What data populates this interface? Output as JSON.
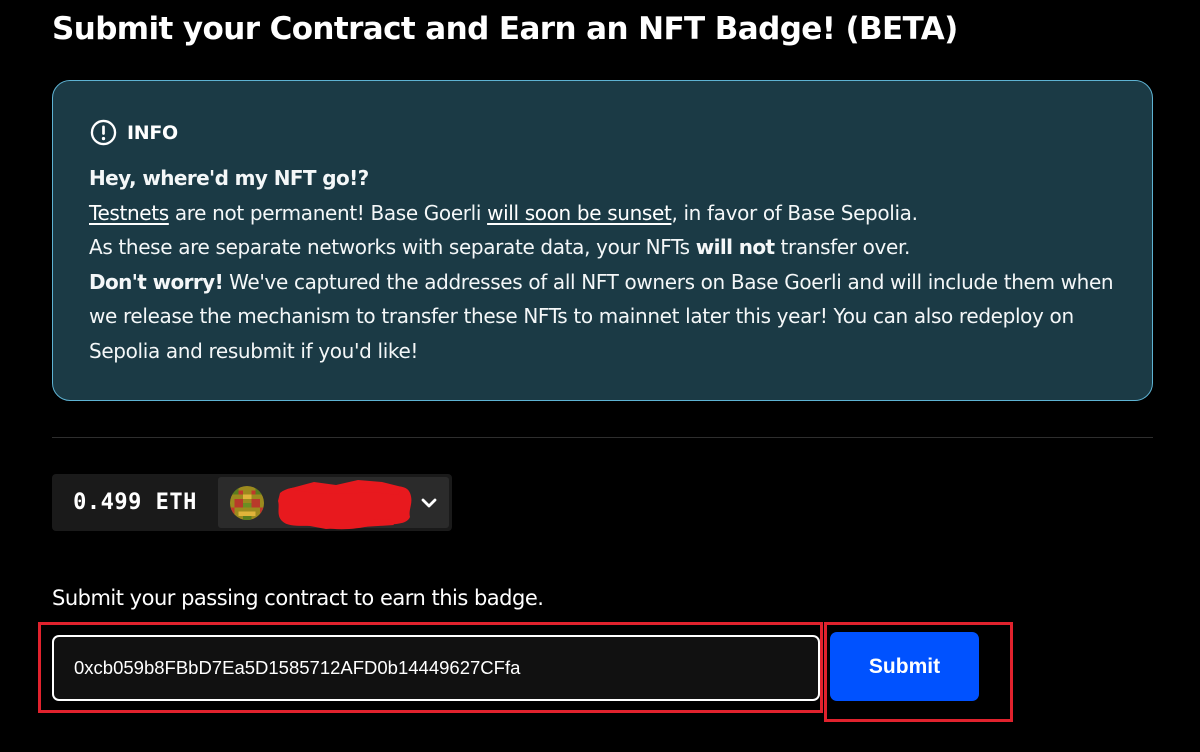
{
  "page": {
    "title": "Submit your Contract and Earn an NFT Badge! (BETA)"
  },
  "info": {
    "icon": "alert-circle-icon",
    "label": "INFO",
    "heading": "Hey, where'd my NFT go!?",
    "line1": {
      "link_testnets": "Testnets",
      "text_a": " are not permanent! Base Goerli ",
      "link_sunset": "will soon be sunset",
      "text_b": ", in favor of Base Sepolia."
    },
    "line2": {
      "text_a": "As these are separate networks with separate data, your NFTs ",
      "bold": "will not",
      "text_b": " transfer over."
    },
    "line3": {
      "bold": "Don't worry!",
      "text": " We've captured the addresses of all NFT owners on Base Goerli and will include them when we release the mechanism to transfer these NFTs to mainnet later this year! You can also redeploy on Sepolia and resubmit if you'd like!"
    },
    "colors": {
      "background": "#1b3a45",
      "border": "#5eb3d3"
    }
  },
  "wallet": {
    "balance": "0.499 ETH",
    "avatar_icon": "identicon-avatar",
    "dropdown_icon": "chevron-down-icon"
  },
  "submission": {
    "prompt": "Submit your passing contract to earn this badge.",
    "address_value": "0xcb059b8FBbD7Ea5D1585712AFD0b14449627CFfa",
    "submit_label": "Submit",
    "highlight_color": "#e0222d",
    "button_color": "#0052ff"
  }
}
